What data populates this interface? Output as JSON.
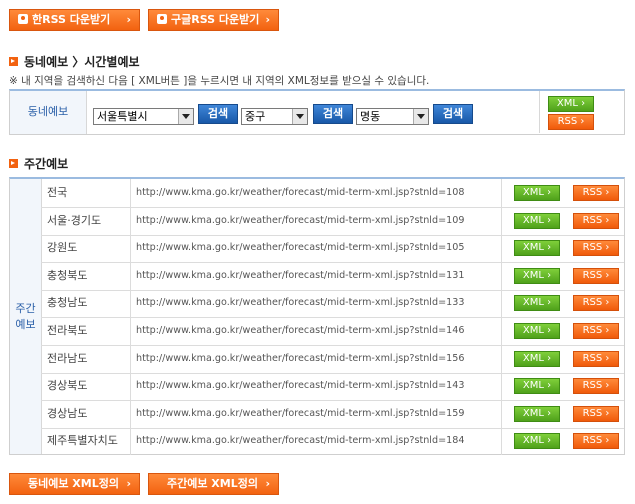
{
  "top_buttons": {
    "hanrss": "한RSS 다운받기",
    "googlerss": "구글RSS 다운받기"
  },
  "section1": {
    "title": "동네예보 〉시간별예보",
    "note": "※ 내 지역을 검색하신 다음 [ XML버튼 ]을 누르시면 내 지역의 XML정보를 받으실 수 있습니다.",
    "row_label": "동네예보",
    "select1": "서울특별시",
    "select2": "중구",
    "select3": "명동",
    "search_label": "검색",
    "xml_label": "XML",
    "rss_label": "RSS"
  },
  "section2": {
    "title": "주간예보",
    "side_label_1": "주간",
    "side_label_2": "예보",
    "xml_label": "XML",
    "rss_label": "RSS",
    "rows": [
      {
        "region": "전국",
        "url": "http://www.kma.go.kr/weather/forecast/mid-term-xml.jsp?stnld=108"
      },
      {
        "region": "서울·경기도",
        "url": "http://www.kma.go.kr/weather/forecast/mid-term-xml.jsp?stnld=109"
      },
      {
        "region": "강원도",
        "url": "http://www.kma.go.kr/weather/forecast/mid-term-xml.jsp?stnld=105"
      },
      {
        "region": "충청북도",
        "url": "http://www.kma.go.kr/weather/forecast/mid-term-xml.jsp?stnld=131"
      },
      {
        "region": "충청남도",
        "url": "http://www.kma.go.kr/weather/forecast/mid-term-xml.jsp?stnld=133"
      },
      {
        "region": "전라북도",
        "url": "http://www.kma.go.kr/weather/forecast/mid-term-xml.jsp?stnld=146"
      },
      {
        "region": "전라남도",
        "url": "http://www.kma.go.kr/weather/forecast/mid-term-xml.jsp?stnld=156"
      },
      {
        "region": "경상북도",
        "url": "http://www.kma.go.kr/weather/forecast/mid-term-xml.jsp?stnld=143"
      },
      {
        "region": "경상남도",
        "url": "http://www.kma.go.kr/weather/forecast/mid-term-xml.jsp?stnld=159"
      },
      {
        "region": "제주특별자치도",
        "url": "http://www.kma.go.kr/weather/forecast/mid-term-xml.jsp?stnld=184"
      }
    ]
  },
  "bottom_buttons": {
    "dongne": "동네예보 XML정의",
    "weekly": "주간예보 XML정의"
  },
  "chevron": "›",
  "colors": {
    "orange": "#f26210",
    "green": "#4fa11b",
    "blue": "#1858a8",
    "label_blue": "#2a5fa8"
  }
}
